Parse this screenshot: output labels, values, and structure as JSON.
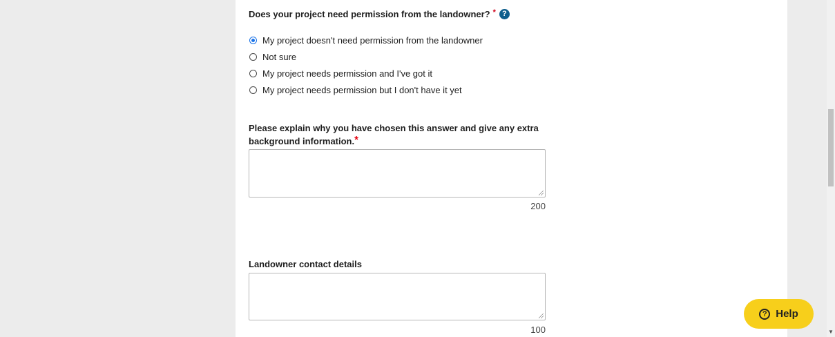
{
  "question": {
    "title": "Does your project need permission from the landowner?",
    "required_marker": "*",
    "help_icon": "?"
  },
  "options": [
    {
      "label": "My project doesn't need permission from the landowner",
      "selected": true
    },
    {
      "label": "Not sure",
      "selected": false
    },
    {
      "label": "My project needs permission and I've got it",
      "selected": false
    },
    {
      "label": "My project needs permission but I don't have it yet",
      "selected": false
    }
  ],
  "explanation": {
    "label": "Please explain why you have chosen this answer and give any extra background information.",
    "required_marker": "*",
    "value": "",
    "counter": "200"
  },
  "contact": {
    "label": "Landowner contact details",
    "value": "",
    "counter": "100"
  },
  "help_button": {
    "icon": "?",
    "label": "Help"
  },
  "colors": {
    "accent": "#1a73e8",
    "help_button": "#f7cf1b",
    "help_icon": "#0d5e8c",
    "required": "#e3000f"
  }
}
